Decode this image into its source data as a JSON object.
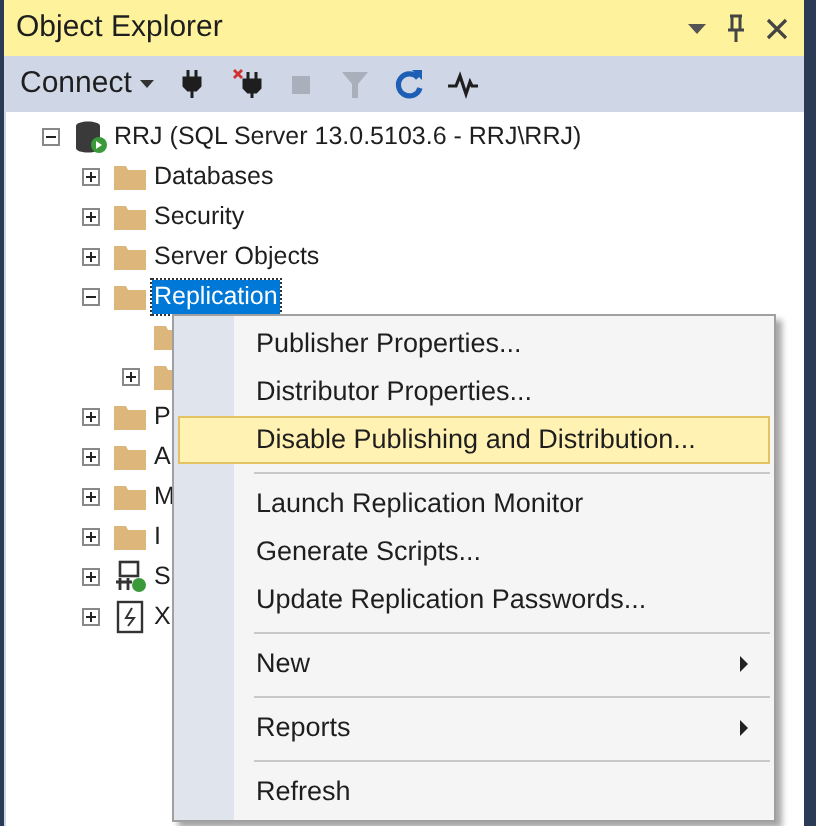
{
  "panel": {
    "title": "Object Explorer"
  },
  "toolbar": {
    "connect_label": "Connect",
    "buttons": [
      {
        "kind": "connect",
        "disabled": false
      },
      {
        "kind": "disconnect",
        "disabled": false
      },
      {
        "kind": "stop",
        "disabled": true
      },
      {
        "kind": "filter",
        "disabled": true
      },
      {
        "kind": "refresh",
        "disabled": false
      },
      {
        "kind": "activity",
        "disabled": false
      }
    ]
  },
  "tree": [
    {
      "label": "RRJ (SQL Server 13.0.5103.6 - RRJ\\RRJ)",
      "kind": "server",
      "expandable": true,
      "expanded": true,
      "selected": false,
      "children": [
        {
          "label": "Databases",
          "kind": "folder",
          "expandable": true,
          "expanded": false,
          "selected": false
        },
        {
          "label": "Security",
          "kind": "folder",
          "expandable": true,
          "expanded": false,
          "selected": false
        },
        {
          "label": "Server Objects",
          "kind": "folder",
          "expandable": true,
          "expanded": false,
          "selected": false
        },
        {
          "label": "Replication",
          "kind": "folder",
          "expandable": true,
          "expanded": true,
          "selected": true,
          "children": [
            {
              "kind": "folder",
              "expandable": false
            },
            {
              "kind": "folder",
              "expandable": true,
              "expanded": false
            }
          ]
        },
        {
          "label": "P",
          "kind": "folder",
          "expandable": true,
          "expanded": false,
          "selected": false
        },
        {
          "label": "A",
          "kind": "folder",
          "expandable": true,
          "expanded": false,
          "selected": false
        },
        {
          "label": "M",
          "kind": "folder",
          "expandable": true,
          "expanded": false,
          "selected": false
        },
        {
          "label": "I",
          "kind": "folder",
          "expandable": true,
          "expanded": false,
          "selected": false
        },
        {
          "label": "S",
          "kind": "agent",
          "expandable": true,
          "expanded": false,
          "selected": false
        },
        {
          "label": "X",
          "kind": "xevent",
          "expandable": true,
          "expanded": false,
          "selected": false
        }
      ]
    }
  ],
  "context_menu": [
    {
      "kind": "item",
      "label": "Publisher Properties...",
      "selected": false,
      "submenu": false
    },
    {
      "kind": "item",
      "label": "Distributor Properties...",
      "selected": false,
      "submenu": false
    },
    {
      "kind": "item",
      "label": "Disable Publishing and Distribution...",
      "selected": true,
      "submenu": false
    },
    {
      "kind": "separator"
    },
    {
      "kind": "item",
      "label": "Launch Replication Monitor",
      "selected": false,
      "submenu": false
    },
    {
      "kind": "item",
      "label": "Generate Scripts...",
      "selected": false,
      "submenu": false
    },
    {
      "kind": "item",
      "label": "Update Replication Passwords...",
      "selected": false,
      "submenu": false
    },
    {
      "kind": "separator"
    },
    {
      "kind": "item",
      "label": "New",
      "selected": false,
      "submenu": true
    },
    {
      "kind": "separator"
    },
    {
      "kind": "item",
      "label": "Reports",
      "selected": false,
      "submenu": true
    },
    {
      "kind": "separator"
    },
    {
      "kind": "item",
      "label": "Refresh",
      "selected": false,
      "submenu": false
    }
  ]
}
